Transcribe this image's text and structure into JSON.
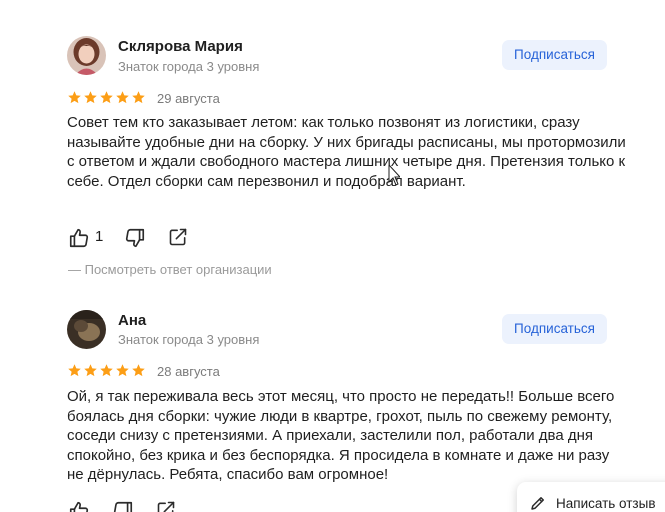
{
  "reviews": [
    {
      "author_name": "Склярова Мария",
      "author_level": "Знаток города 3 уровня",
      "subscribe_label": "Подписаться",
      "rating": 5,
      "rating_max": 5,
      "date": "29 августа",
      "text": "Совет тем кто заказывает летом: как только позвонят из логистики, сразу называйте удобные дни на сборку. У них бригады расписаны, мы протормозили с ответом и ждали свободного мастера лишних четыре дня. Претензия только к себе. Отдел сборки сам перезвонил и подобрал вариант.",
      "likes": "1",
      "org_reply_link": "— Посмотреть ответ организации",
      "avatar_icon": "user-photo-woman"
    },
    {
      "author_name": "Ана",
      "author_level": "Знаток города 3 уровня",
      "subscribe_label": "Подписаться",
      "rating": 5,
      "rating_max": 5,
      "date": "28 августа",
      "text": "Ой, я так переживала весь этот месяц, что просто не передать!! Больше всего боялась дня сборки: чужие люди в квартре, грохот, пыль по свежему ремонту, соседи снизу с претензиями. А приехали, застелили пол, работали два дня спокойно, без крика и без беспорядка. Я просидела в комнате и даже ни разу не дёрнулась. Ребята, спасибо вам огромное!",
      "avatar_icon": "user-photo-dark"
    }
  ],
  "write_review_label": "Написать отзыв",
  "icons": {
    "like": "thumbs-up-icon",
    "dislike": "thumbs-down-icon",
    "share": "share-icon",
    "star": "star-icon",
    "pen": "pen-icon"
  },
  "colors": {
    "star": "#fc9e16",
    "subscribe_bg": "#ecf2fd",
    "subscribe_text": "#2763d8",
    "muted_text": "#8a8a8a"
  }
}
